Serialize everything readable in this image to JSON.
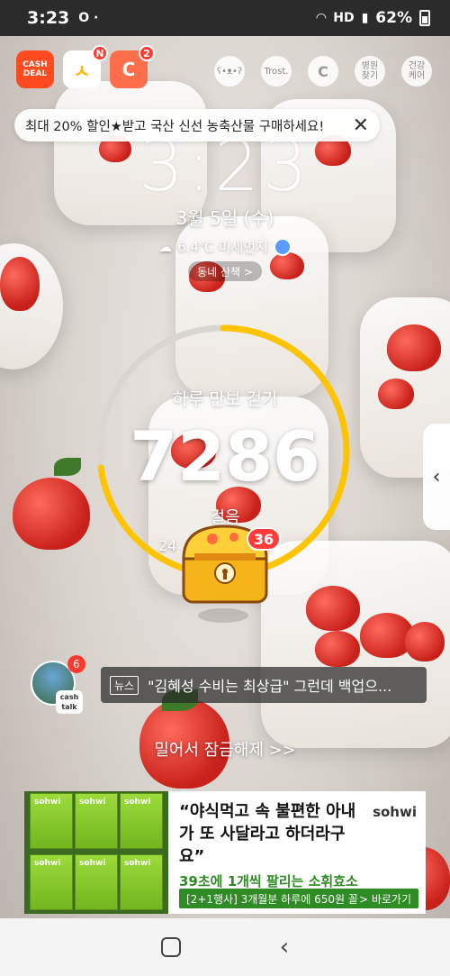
{
  "status_bar": {
    "time": "3:23",
    "indicators": "O ·",
    "signal_text": "HD",
    "battery": "62%"
  },
  "top_apps": [
    {
      "name": "CASH DEAL",
      "icon": "cashdeal-icon",
      "badge": ""
    },
    {
      "name": "",
      "icon": "app-n-icon",
      "badge": "N"
    },
    {
      "name": "",
      "icon": "cashwalk-c-icon",
      "badge": "2"
    }
  ],
  "right_icons": [
    {
      "icon": "bear-icon",
      "label": ""
    },
    {
      "icon": "trost-icon",
      "label": "Trost."
    },
    {
      "icon": "coin-c-icon",
      "label": ""
    },
    {
      "icon": "hospital-find-icon",
      "label": "병원\n찾기"
    },
    {
      "icon": "health-care-icon",
      "label": "건강\n케어"
    }
  ],
  "promo": {
    "text": "최대 20% 할인★받고 국산 신선 농축산물 구매하세요!",
    "close": "✕"
  },
  "clock": {
    "time": "3:23",
    "date": "3월 5일 (수)",
    "weather": "6.4℃ 미세먼지",
    "walk_button": "동네 산책 >"
  },
  "pedometer": {
    "title": "하루 만보 걷기",
    "steps": "7286",
    "unit": "걸음",
    "sub": "24",
    "chest_badge": "36",
    "progress": 0.7286
  },
  "news": {
    "avatar_badge": "6",
    "cashtalk": "cash talk",
    "tag": "뉴스",
    "headline": "\"김혜성 수비는 최상급\" 그런데 백업으..."
  },
  "unlock_text": "밀어서 잠금해제 >>",
  "ad": {
    "brand": "sohwi",
    "headline": "“야식먹고 속 불편한 아내가 또 사달라고 하더라구요”",
    "sub": "39초에 1개씩 팔리는 소휘효소",
    "cta_left": "[2+1행사] 3개월분 하루에 650원 꼴",
    "cta_right": "> 바로가기",
    "box_label": "sohwi"
  },
  "colors": {
    "ring_track": "#d9d6d2",
    "ring_progress": "#ffc400",
    "badge_red": "#ff3b30",
    "ad_green": "#2f8b24"
  }
}
